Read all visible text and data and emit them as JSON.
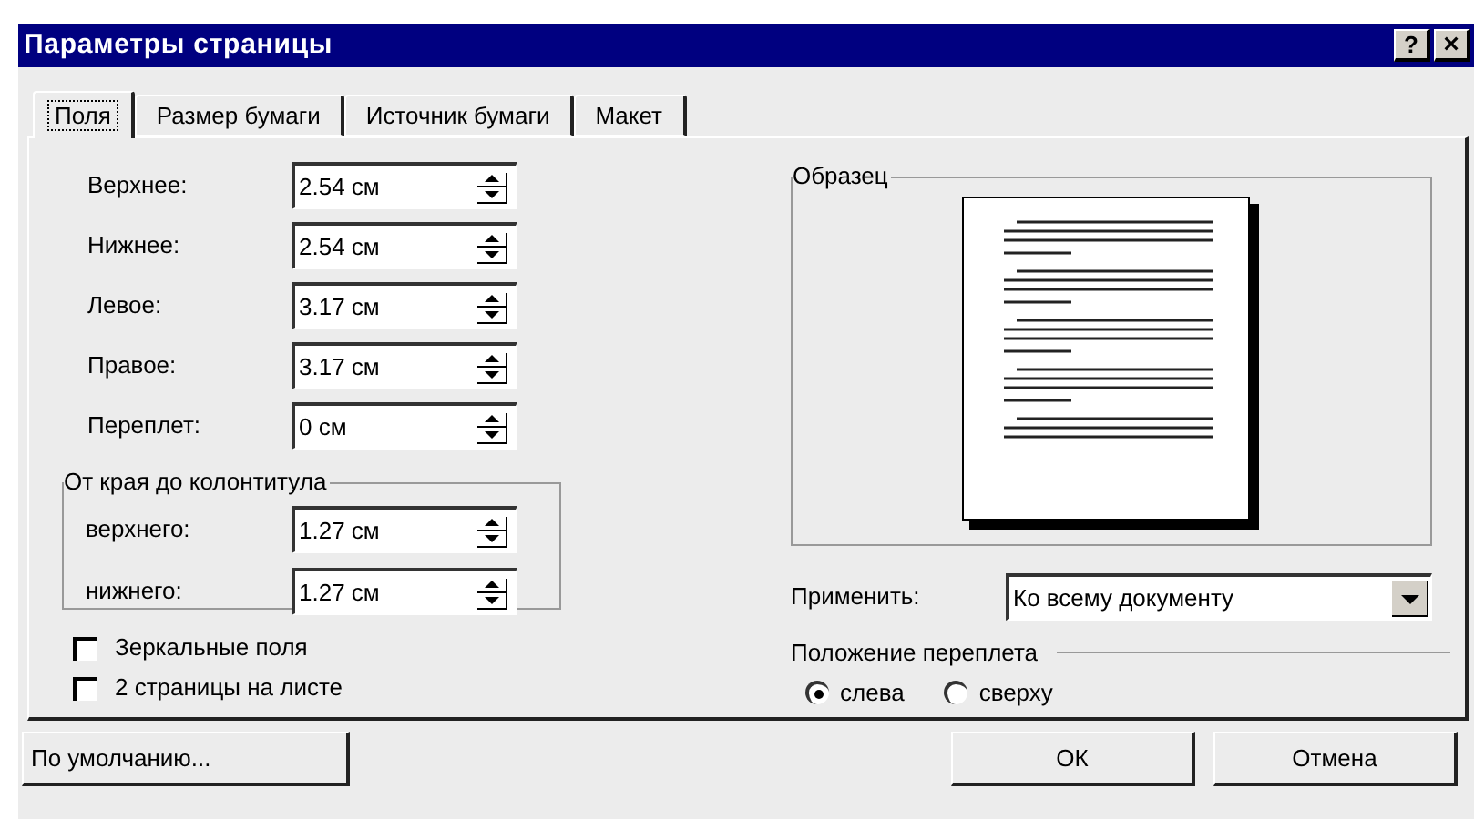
{
  "window": {
    "title": "Параметры страницы",
    "help_button": "?",
    "close_button": "×"
  },
  "tabs": [
    {
      "label": "Поля",
      "selected": true
    },
    {
      "label": "Размер бумаги",
      "selected": false
    },
    {
      "label": "Источник бумаги",
      "selected": false
    },
    {
      "label": "Макет",
      "selected": false
    }
  ],
  "margins": [
    {
      "label": "Верхнее:",
      "value": "2.54 см"
    },
    {
      "label": "Нижнее:",
      "value": "2.54 см"
    },
    {
      "label": "Левое:",
      "value": "3.17 см"
    },
    {
      "label": "Правое:",
      "value": "3.17 см"
    },
    {
      "label": "Переплет:",
      "value": "0 см"
    }
  ],
  "header_footer": {
    "title": "От края до колонтитула",
    "fields": [
      {
        "label": "верхнего:",
        "value": "1.27 см"
      },
      {
        "label": "нижнего:",
        "value": "1.27 см"
      }
    ]
  },
  "options": [
    {
      "label": "Зеркальные поля",
      "checked": false
    },
    {
      "label": "2 страницы на листе",
      "checked": false
    }
  ],
  "preview": {
    "title": "Образец"
  },
  "apply": {
    "label": "Применить:",
    "value": "Ко всему документу"
  },
  "gutter_position": {
    "title": "Положение переплета",
    "choices": [
      {
        "label": "слева",
        "selected": true
      },
      {
        "label": "сверху",
        "selected": false
      }
    ]
  },
  "buttons": [
    {
      "label": "По умолчанию...",
      "kind": "default"
    },
    {
      "label": "ОК",
      "kind": "ok"
    },
    {
      "label": "Отмена",
      "kind": "cancel"
    }
  ]
}
